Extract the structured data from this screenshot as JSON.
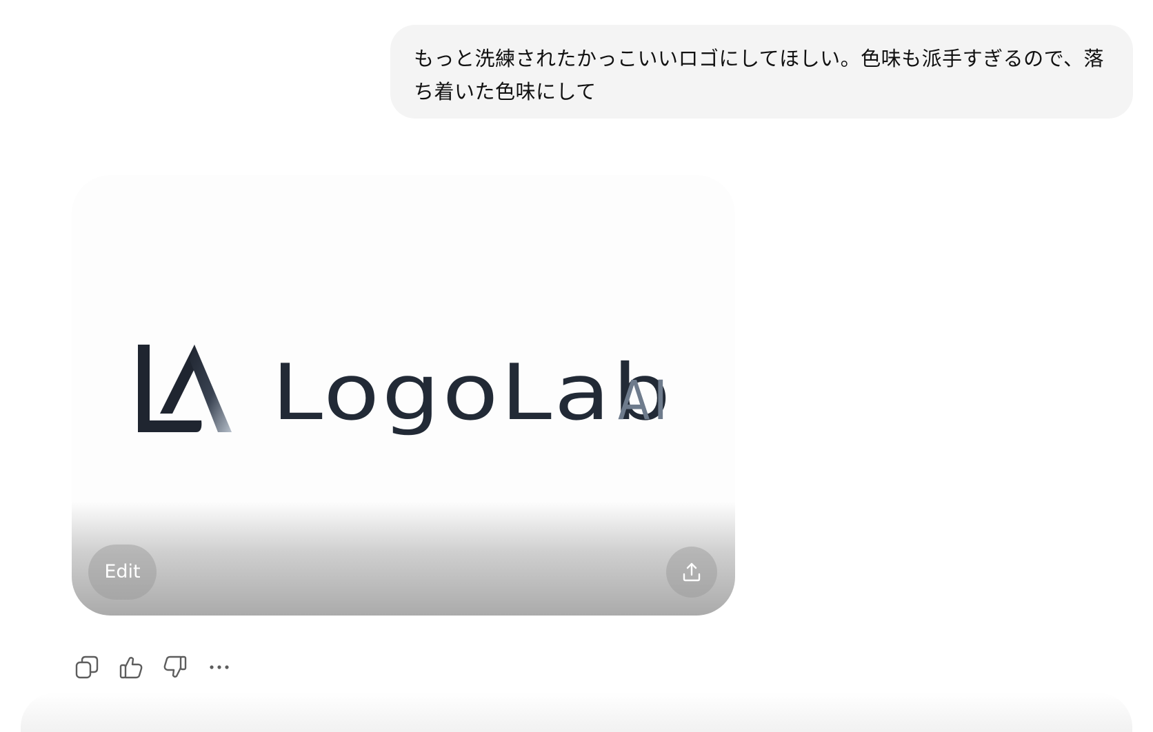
{
  "conversation": {
    "user_message": "もっと洗練されたかっこいいロゴにしてほしい。色味も派手すぎるので、落ち着いた色味にして"
  },
  "generated_image": {
    "logo_wordmark": "LogoLab",
    "logo_suffix": "AI",
    "logo_mark_letters": "LA",
    "colors": {
      "wordmark": "#222a36",
      "suffix": "#6e7b8c",
      "mark": "#1f2530",
      "background": "#fdfdfd"
    },
    "edit_label": "Edit",
    "share_icon": "share-upload-icon"
  },
  "message_actions": {
    "icons": [
      "copy-icon",
      "thumbs-up-icon",
      "thumbs-down-icon",
      "more-icon"
    ]
  }
}
